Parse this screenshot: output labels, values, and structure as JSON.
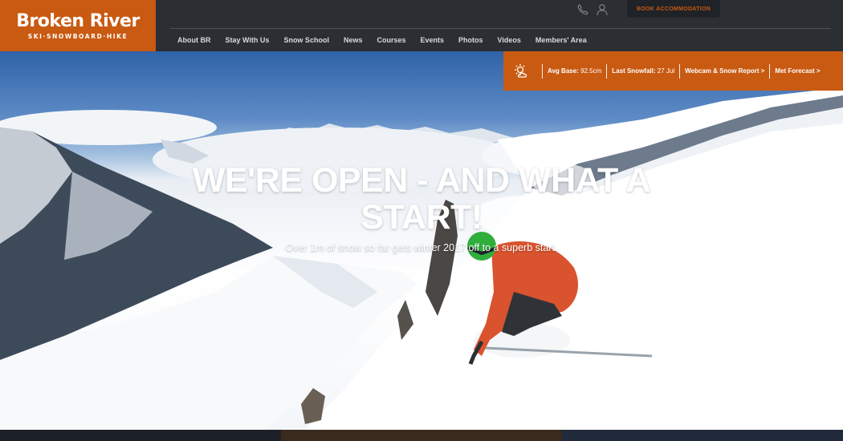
{
  "brand": {
    "name": "Broken River",
    "tagline": "SKI·SNOWBOARD·HIKE"
  },
  "header": {
    "phone_icon": "phone-icon",
    "user_icon": "user-icon",
    "book_label": "BOOK ACCOMMODATION"
  },
  "nav": {
    "items": [
      {
        "label": "About BR"
      },
      {
        "label": "Stay With Us"
      },
      {
        "label": "Snow School"
      },
      {
        "label": "News"
      },
      {
        "label": "Courses"
      },
      {
        "label": "Events"
      },
      {
        "label": "Photos"
      },
      {
        "label": "Videos"
      },
      {
        "label": "Members' Area"
      }
    ]
  },
  "conditions": {
    "weather_icon": "partly-cloudy-icon",
    "avg_base_label": "Avg Base:",
    "avg_base_value": "92.5cm",
    "last_snowfall_label": "Last Snowfall:",
    "last_snowfall_value": "27 Jul",
    "webcam_link": "Webcam & Snow Report >",
    "forecast_link": "Met Forecast >"
  },
  "hero": {
    "headline": "WE'RE OPEN - AND WHAT A START!",
    "subline": "Over 1m of snow so far gets winter 2017 off to a superb start."
  },
  "colors": {
    "brand_orange": "#c95a12",
    "header_dark": "#2b2f34"
  }
}
